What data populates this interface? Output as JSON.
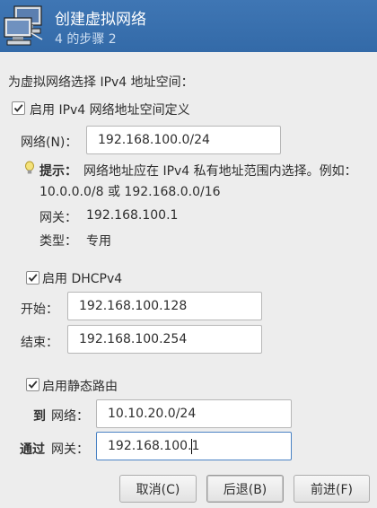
{
  "window": {
    "title": "创建虚拟网络",
    "step": "4 的步骤 2"
  },
  "ipv4": {
    "prompt": "为虚拟网络选择 IPv4 地址空间：",
    "enable_label": "启用 IPv4 网络地址空间定义",
    "enabled": true,
    "network_label": "网络(N)：",
    "network_value": "192.168.100.0/24",
    "hint_label": "提示：",
    "hint_line1": "网络地址应在 IPv4 私有地址范围内选择。例如：",
    "hint_line2": "10.0.0.0/8 或 192.168.0.0/16",
    "gateway_label": "网关：",
    "gateway_value": "192.168.100.1",
    "type_label": "类型：",
    "type_value": "专用"
  },
  "dhcp": {
    "enable_label": "启用 DHCPv4",
    "enabled": true,
    "start_label": "开始：",
    "start_value": "192.168.100.128",
    "end_label": "结束：",
    "end_value": "192.168.100.254"
  },
  "static_route": {
    "enable_label": "启用静态路由",
    "enabled": true,
    "to_bold": "到",
    "to_label": "网络：",
    "to_value": "10.10.20.0/24",
    "via_bold": "通过",
    "via_label": "网关：",
    "via_value": "192.168.100.1"
  },
  "buttons": {
    "cancel": "取消(C)",
    "back": "后退(B)",
    "forward": "前进(F)"
  },
  "icons": {
    "header": "network-computers-icon",
    "hint": "lightbulb-icon",
    "check": "checkmark-icon"
  },
  "colors": {
    "header_bg": "#3d74b2",
    "header_subtitle": "#cfdff2",
    "focus_border": "#4a82c4"
  }
}
